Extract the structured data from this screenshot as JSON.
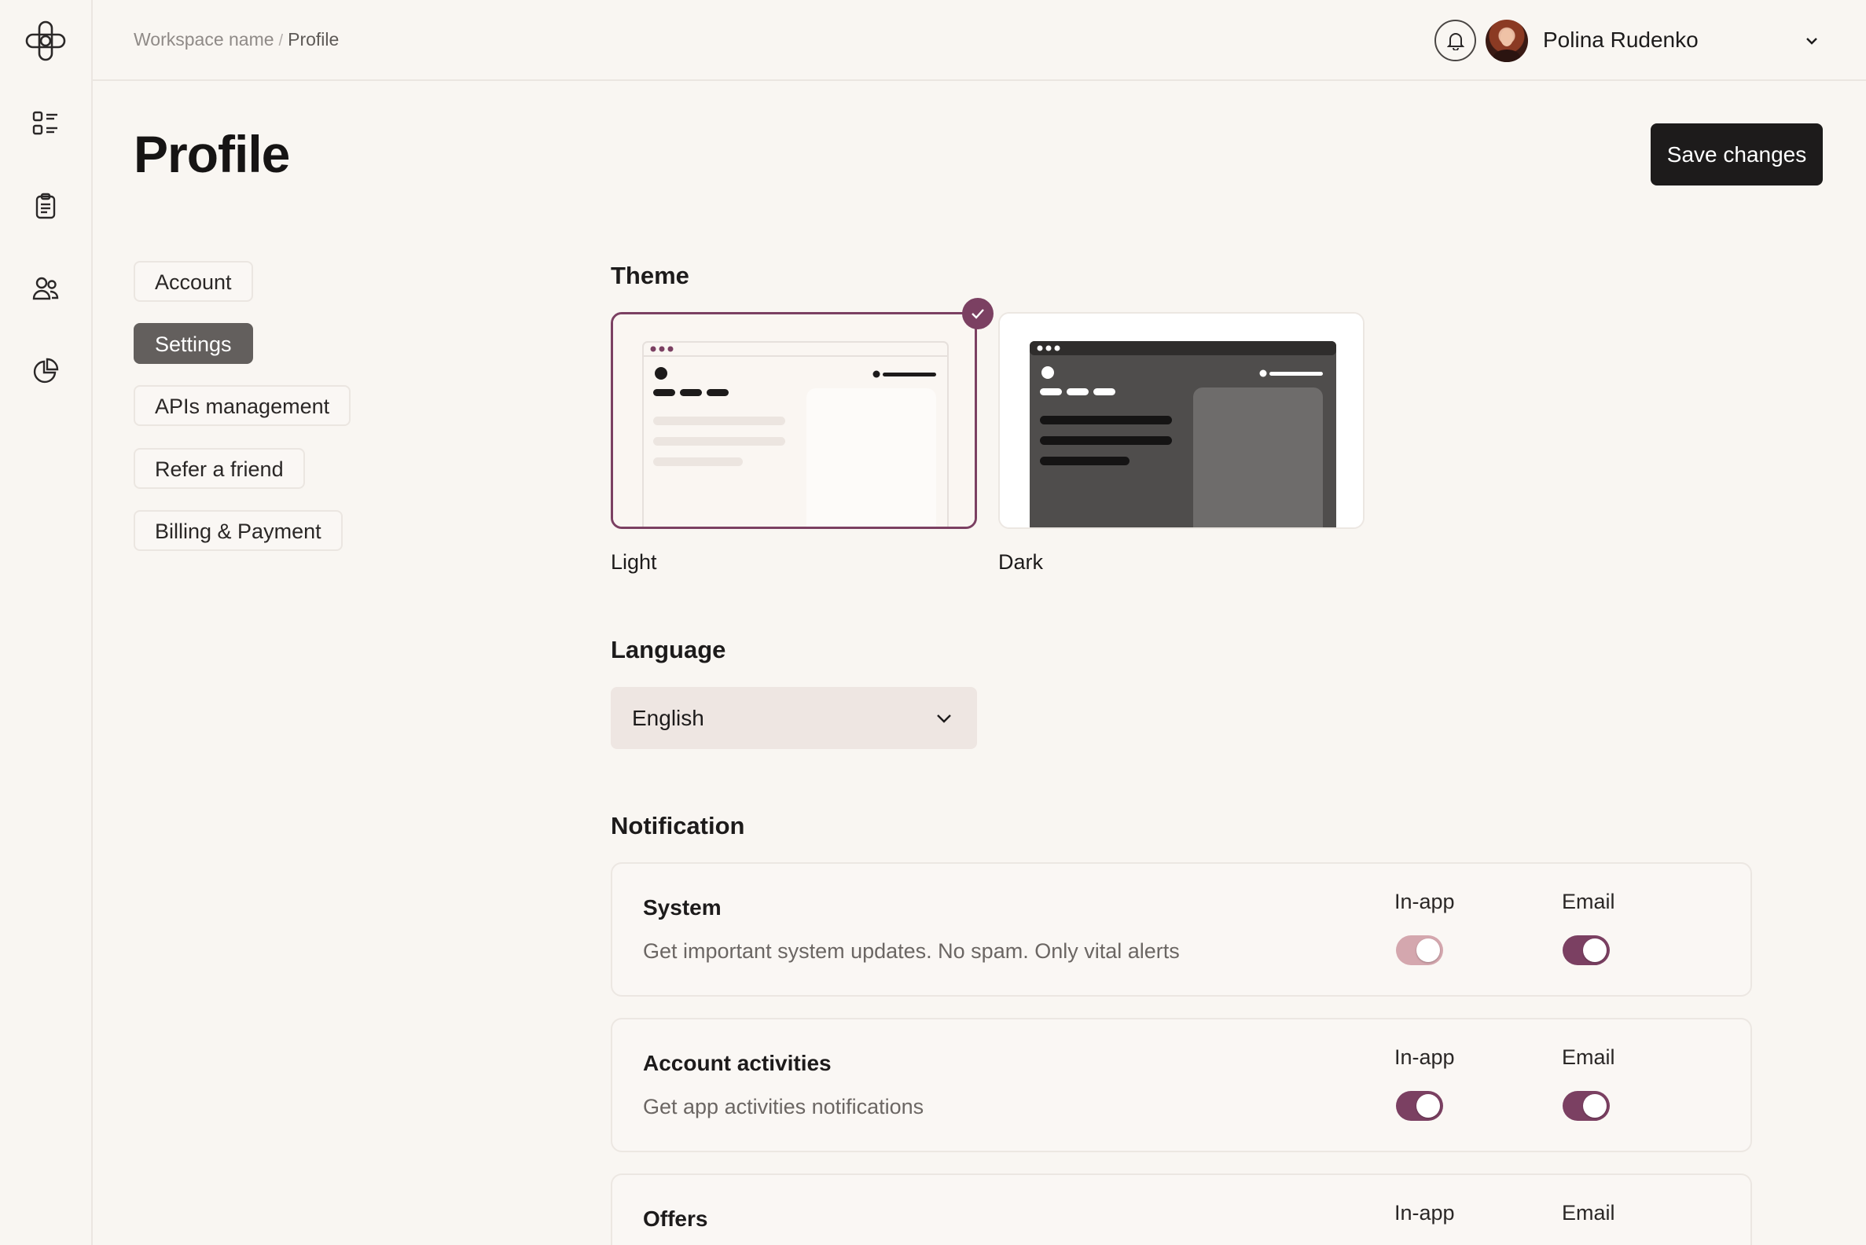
{
  "colors": {
    "accent": "#7b4062",
    "accent_soft": "#d4a7ae",
    "dark": "#1d1b1b",
    "background": "#f9f6f2"
  },
  "sidebar": {
    "icons": [
      "logo-icon",
      "list-icon",
      "clipboard-icon",
      "users-icon",
      "pie-chart-icon"
    ]
  },
  "breadcrumb": {
    "workspace": "Workspace name",
    "separator": "/",
    "current": "Profile"
  },
  "user": {
    "name": "Polina Rudenko"
  },
  "page": {
    "title": "Profile",
    "save_label": "Save changes"
  },
  "subnav": {
    "items": [
      {
        "label": "Account",
        "active": false
      },
      {
        "label": "Settings",
        "active": true
      },
      {
        "label": "APIs management",
        "active": false
      },
      {
        "label": "Refer a friend",
        "active": false
      },
      {
        "label": "Billing & Payment",
        "active": false
      }
    ]
  },
  "theme": {
    "title": "Theme",
    "options": [
      {
        "label": "Light",
        "selected": true
      },
      {
        "label": "Dark",
        "selected": false
      }
    ]
  },
  "language": {
    "title": "Language",
    "value": "English"
  },
  "notification": {
    "title": "Notification",
    "col_inapp": "In-app",
    "col_email": "Email",
    "rows": [
      {
        "title": "System",
        "desc": "Get important system updates. No spam. Only vital alerts",
        "inapp": "on-soft",
        "email": "on"
      },
      {
        "title": "Account activities",
        "desc": "Get app activities notifications",
        "inapp": "on",
        "email": "on"
      },
      {
        "title": "Offers",
        "desc": "",
        "inapp": "",
        "email": ""
      }
    ]
  }
}
